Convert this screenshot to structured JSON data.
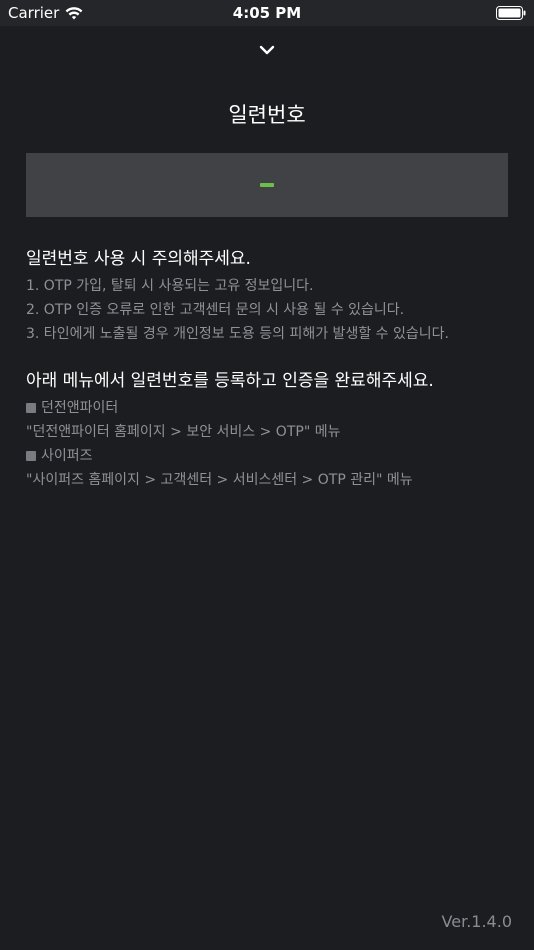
{
  "status_bar": {
    "carrier": "Carrier",
    "time": "4:05 PM"
  },
  "header": {
    "title": "일련번호",
    "collapse_icon": "chevron-down-icon"
  },
  "otp": {
    "placeholder": "-",
    "accent_color": "#6cc04a"
  },
  "caution": {
    "title": "일련번호 사용 시 주의해주세요.",
    "items": [
      "1. OTP 가입, 탈퇴 시 사용되는 고유 정보입니다.",
      "2. OTP 인증 오류로 인한 고객센터 문의 시 사용 될 수 있습니다.",
      "3. 타인에게 노출될 경우 개인정보 도용 등의 피해가 발생할 수 있습니다."
    ]
  },
  "register": {
    "title": "아래 메뉴에서 일련번호를 등록하고 인증을 완료해주세요.",
    "menus": [
      {
        "name": "던전앤파이터",
        "path": "\"던전앤파이터 홈페이지 > 보안 서비스 > OTP\" 메뉴"
      },
      {
        "name": "사이퍼즈",
        "path": "\"사이퍼즈 홈페이지 > 고객센터 > 서비스센터 > OTP 관리\" 메뉴"
      }
    ]
  },
  "footer": {
    "version": "Ver.1.4.0"
  },
  "colors": {
    "background": "#1c1d21",
    "panel": "#414245",
    "muted_text": "#909196"
  }
}
